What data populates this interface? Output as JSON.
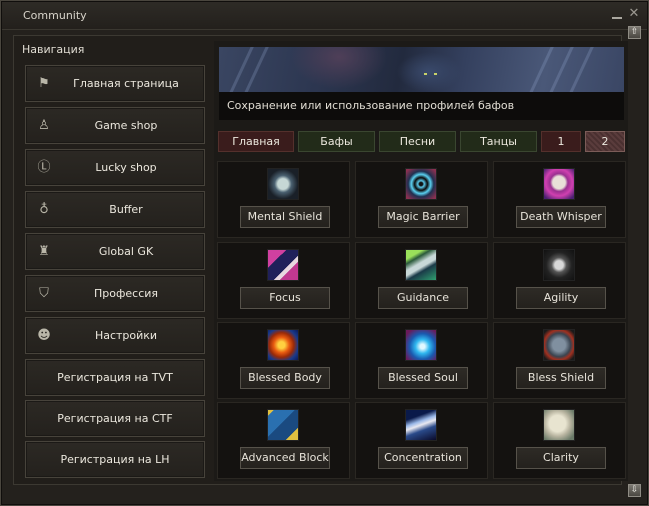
{
  "window": {
    "title": "Community",
    "minimize_icon": "minimize-icon",
    "close_icon": "close-icon",
    "close_glyph": "✕",
    "scroll_up_glyph": "⇧",
    "scroll_down_glyph": "⇩"
  },
  "navigation": {
    "heading": "Навигация",
    "items": [
      {
        "label": "Главная страница",
        "icon": "flag-icon",
        "glyph": "⚑"
      },
      {
        "label": "Game shop",
        "icon": "bag-icon",
        "glyph": "♙"
      },
      {
        "label": "Lucky shop",
        "icon": "coin-icon",
        "glyph": "Ⓛ"
      },
      {
        "label": "Buffer",
        "icon": "potion-icon",
        "glyph": "♁"
      },
      {
        "label": "Global GK",
        "icon": "gatekeeper-icon",
        "glyph": "♜"
      },
      {
        "label": "Профессия",
        "icon": "shield-icon",
        "glyph": "⛉"
      },
      {
        "label": "Настройки",
        "icon": "users-icon",
        "glyph": "☻"
      },
      {
        "label": "Регистрация на TVT"
      },
      {
        "label": "Регистрация на CTF"
      },
      {
        "label": "Регистрация на LH"
      }
    ]
  },
  "banner": {
    "caption": "Сохранение или использование профилей бафов"
  },
  "tabs": [
    {
      "label": "Главная",
      "style": "red"
    },
    {
      "label": "Бафы",
      "style": "green"
    },
    {
      "label": "Песни",
      "style": "green"
    },
    {
      "label": "Танцы",
      "style": "green"
    },
    {
      "label": "1",
      "style": "red"
    },
    {
      "label": "2",
      "style": "active"
    }
  ],
  "buffs": [
    {
      "name": "Mental Shield",
      "icon": "mental-shield-icon"
    },
    {
      "name": "Magic Barrier",
      "icon": "magic-barrier-icon"
    },
    {
      "name": "Death Whisper",
      "icon": "death-whisper-icon"
    },
    {
      "name": "Focus",
      "icon": "focus-icon"
    },
    {
      "name": "Guidance",
      "icon": "guidance-icon"
    },
    {
      "name": "Agility",
      "icon": "agility-icon"
    },
    {
      "name": "Blessed Body",
      "icon": "blessed-body-icon"
    },
    {
      "name": "Blessed Soul",
      "icon": "blessed-soul-icon"
    },
    {
      "name": "Bless Shield",
      "icon": "bless-shield-icon"
    },
    {
      "name": "Advanced Block",
      "icon": "advanced-block-icon"
    },
    {
      "name": "Concentration",
      "icon": "concentration-icon"
    },
    {
      "name": "Clarity",
      "icon": "clarity-icon"
    }
  ]
}
